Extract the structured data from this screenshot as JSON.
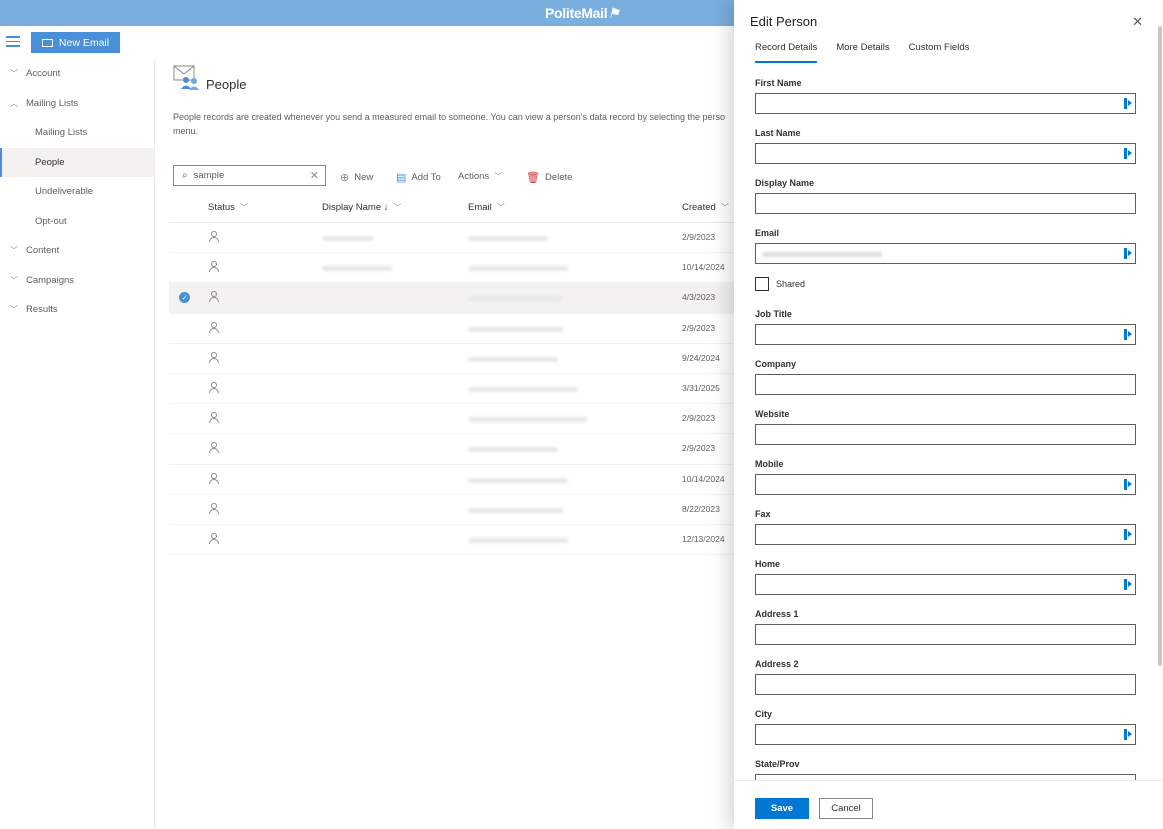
{
  "app": {
    "brand": "PoliteMail"
  },
  "toolbar": {
    "new_email_label": "New Email"
  },
  "nav": [
    {
      "label": "Account",
      "chevron": "chevron-down-icon",
      "sub": false,
      "active": false
    },
    {
      "label": "Mailing Lists",
      "chevron": "chevron-up-icon",
      "sub": false,
      "active": false
    },
    {
      "label": "Mailing Lists",
      "sub": true,
      "active": false
    },
    {
      "label": "People",
      "sub": true,
      "active": true
    },
    {
      "label": "Undeliverable",
      "sub": true,
      "active": false
    },
    {
      "label": "Opt-out",
      "sub": true,
      "active": false
    },
    {
      "label": "Content",
      "chevron": "chevron-down-icon",
      "sub": false,
      "active": false
    },
    {
      "label": "Campaigns",
      "chevron": "chevron-down-icon",
      "sub": false,
      "active": false
    },
    {
      "label": "Results",
      "chevron": "chevron-down-icon",
      "sub": false,
      "active": false
    }
  ],
  "page": {
    "title": "People",
    "description": "People records are created whenever you send a measured email to someone. You can view a person's data record by selecting the perso menu."
  },
  "search": {
    "value": "sample"
  },
  "actions": {
    "new": "New",
    "add_to": "Add To",
    "actions": "Actions",
    "delete": "Delete"
  },
  "table": {
    "columns": {
      "status": "Status",
      "display_name": "Display Name ↓",
      "email": "Email",
      "created": "Created"
    },
    "rows": [
      {
        "created": "2/9/2023",
        "selected": false
      },
      {
        "created": "10/14/2024",
        "selected": false
      },
      {
        "created": "4/3/2023",
        "selected": true
      },
      {
        "created": "2/9/2023",
        "selected": false
      },
      {
        "created": "9/24/2024",
        "selected": false
      },
      {
        "created": "3/31/2025",
        "selected": false
      },
      {
        "created": "2/9/2023",
        "selected": false
      },
      {
        "created": "2/9/2023",
        "selected": false
      },
      {
        "created": "10/14/2024",
        "selected": false
      },
      {
        "created": "8/22/2023",
        "selected": false
      },
      {
        "created": "12/13/2024",
        "selected": false
      }
    ]
  },
  "panel": {
    "title": "Edit Person",
    "tabs": [
      "Record Details",
      "More Details",
      "Custom Fields"
    ],
    "active_tab": "Record Details",
    "fields": [
      {
        "label": "First Name",
        "value": "",
        "ai": true
      },
      {
        "label": "Last Name",
        "value": "",
        "ai": true
      },
      {
        "label": "Display Name",
        "value": "",
        "ai": false
      },
      {
        "label": "Email",
        "value": "",
        "ai": true,
        "blurred": true
      }
    ],
    "shared_label": "Shared",
    "fields2": [
      {
        "label": "Job Title",
        "value": "",
        "ai": true
      },
      {
        "label": "Company",
        "value": "",
        "ai": false
      },
      {
        "label": "Website",
        "value": "",
        "ai": false
      },
      {
        "label": "Mobile",
        "value": "",
        "ai": true
      },
      {
        "label": "Fax",
        "value": "",
        "ai": true
      },
      {
        "label": "Home",
        "value": "",
        "ai": true
      },
      {
        "label": "Address 1",
        "value": "",
        "ai": false
      },
      {
        "label": "Address 2",
        "value": "",
        "ai": false
      },
      {
        "label": "City",
        "value": "",
        "ai": true
      },
      {
        "label": "State/Prov",
        "value": "",
        "ai": false
      }
    ],
    "save_label": "Save",
    "cancel_label": "Cancel"
  },
  "colors": {
    "topbar": "#7aaedf",
    "accent": "#4a90d9",
    "primary": "#0078d4"
  }
}
